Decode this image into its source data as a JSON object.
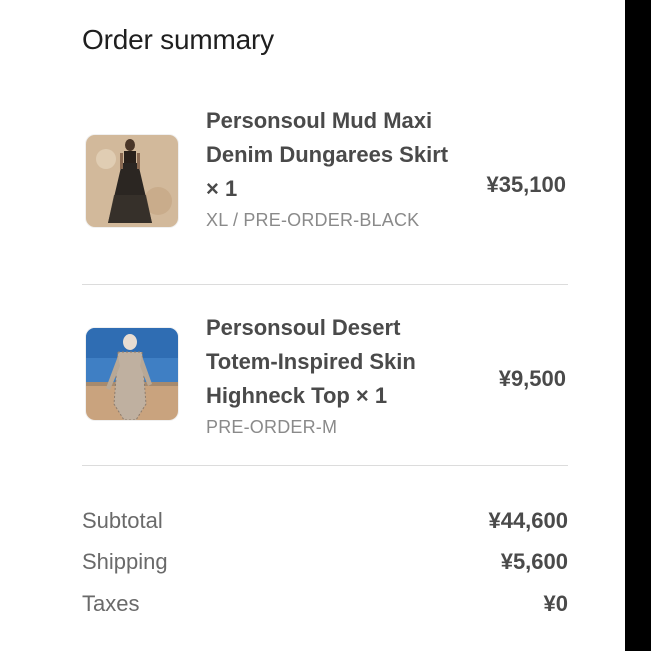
{
  "summary": {
    "title": "Order summary"
  },
  "items": [
    {
      "name": "Personsoul Mud Maxi Denim Dungarees Skirt × 1",
      "variant": "XL / PRE-ORDER-BLACK",
      "price": "¥35,100",
      "image_icon": "product-photo-skirt"
    },
    {
      "name": "Personsoul Desert Totem-Inspired Skin Highneck Top × 1",
      "variant": "PRE-ORDER-M",
      "price": "¥9,500",
      "image_icon": "product-photo-top"
    }
  ],
  "totals": {
    "subtotal_label": "Subtotal",
    "subtotal_value": "¥44,600",
    "shipping_label": "Shipping",
    "shipping_value": "¥5,600",
    "taxes_label": "Taxes",
    "taxes_value": "¥0"
  }
}
